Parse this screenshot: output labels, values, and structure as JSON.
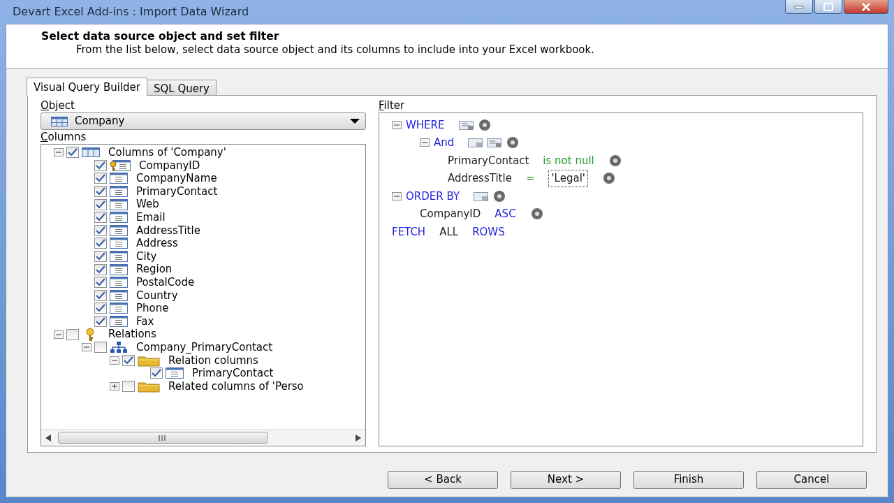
{
  "window": {
    "title": "Devart Excel Add-ins : Import Data Wizard"
  },
  "header": {
    "title": "Select data source object and set filter",
    "description": "From the list below, select data source object and its columns to include into your Excel workbook."
  },
  "tabs": [
    {
      "label": "Visual Query Builder",
      "selected": true
    },
    {
      "label": "SQL Query",
      "selected": false
    }
  ],
  "object": {
    "label": "Object",
    "value": "Company"
  },
  "columns": {
    "label": "Columns",
    "tree": [
      {
        "label": "Columns of 'Company'",
        "kind": "table",
        "checked": true,
        "expanded": true,
        "children": [
          {
            "label": "CompanyID",
            "kind": "key-column",
            "checked": true
          },
          {
            "label": "CompanyName",
            "kind": "column",
            "checked": true
          },
          {
            "label": "PrimaryContact",
            "kind": "column",
            "checked": true
          },
          {
            "label": "Web",
            "kind": "column",
            "checked": true
          },
          {
            "label": "Email",
            "kind": "column",
            "checked": true
          },
          {
            "label": "AddressTitle",
            "kind": "column",
            "checked": true
          },
          {
            "label": "Address",
            "kind": "column",
            "checked": true
          },
          {
            "label": "City",
            "kind": "column",
            "checked": true
          },
          {
            "label": "Region",
            "kind": "column",
            "checked": true
          },
          {
            "label": "PostalCode",
            "kind": "column",
            "checked": true
          },
          {
            "label": "Country",
            "kind": "column",
            "checked": true
          },
          {
            "label": "Phone",
            "kind": "column",
            "checked": true
          },
          {
            "label": "Fax",
            "kind": "column",
            "checked": true
          }
        ]
      },
      {
        "label": "Relations",
        "kind": "key",
        "checked": false,
        "expanded": true,
        "children": [
          {
            "label": "Company_PrimaryContact",
            "kind": "relation",
            "checked": false,
            "expanded": true,
            "children": [
              {
                "label": "Relation columns",
                "kind": "folder",
                "checked": true,
                "expanded": true,
                "children": [
                  {
                    "label": "PrimaryContact",
                    "kind": "column",
                    "checked": true
                  }
                ]
              },
              {
                "label": "Related columns of 'Perso",
                "kind": "folder",
                "checked": false,
                "expanded": false
              }
            ]
          }
        ]
      }
    ]
  },
  "filter": {
    "label": "Filter",
    "tree": [
      {
        "kind": "where",
        "expanded": true,
        "parts": [
          {
            "text": "WHERE",
            "kind": "keyword"
          }
        ],
        "children": [
          {
            "kind": "group",
            "expanded": true,
            "parts": [
              {
                "text": "And",
                "kind": "keyword"
              }
            ],
            "children": [
              {
                "kind": "condition",
                "parts": [
                  {
                    "text": "PrimaryContact",
                    "kind": "field"
                  },
                  {
                    "text": "is not null",
                    "kind": "operator"
                  }
                ]
              },
              {
                "kind": "condition",
                "parts": [
                  {
                    "text": "AddressTitle",
                    "kind": "field"
                  },
                  {
                    "text": "=",
                    "kind": "operator"
                  },
                  {
                    "text": "'Legal'",
                    "kind": "value"
                  }
                ]
              }
            ]
          }
        ]
      },
      {
        "kind": "order",
        "expanded": true,
        "parts": [
          {
            "text": "ORDER BY",
            "kind": "keyword"
          }
        ],
        "children": [
          {
            "kind": "sort",
            "parts": [
              {
                "text": "CompanyID",
                "kind": "field"
              },
              {
                "text": "ASC",
                "kind": "keyword"
              }
            ]
          }
        ]
      },
      {
        "kind": "fetch",
        "parts": [
          {
            "text": "FETCH",
            "kind": "keyword"
          },
          {
            "text": "ALL",
            "kind": "field"
          },
          {
            "text": "ROWS",
            "kind": "keyword"
          }
        ]
      }
    ]
  },
  "buttons": [
    "< Back",
    "Next >",
    "Finish",
    "Cancel"
  ]
}
